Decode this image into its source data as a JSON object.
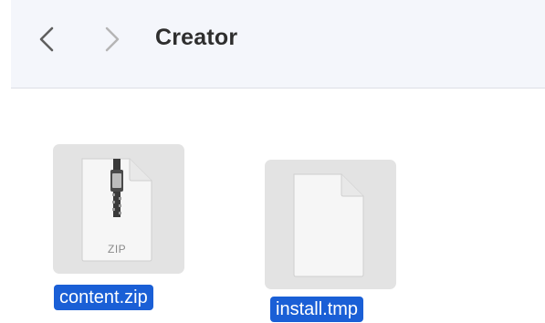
{
  "window": {
    "title": "Creator"
  },
  "navigation": {
    "back_icon": "chevron-left-icon",
    "forward_icon": "chevron-right-icon"
  },
  "files": [
    {
      "name": "content.zip",
      "icon": "zip-archive-icon",
      "icon_caption": "ZIP",
      "selected": true
    },
    {
      "name": "install.tmp",
      "icon": "generic-document-icon",
      "selected": true
    }
  ],
  "colors": {
    "selection": "#1a5fd6",
    "toolbar_bg": "#f4f6fb",
    "icon_tile_bg": "#e3e3e3"
  }
}
